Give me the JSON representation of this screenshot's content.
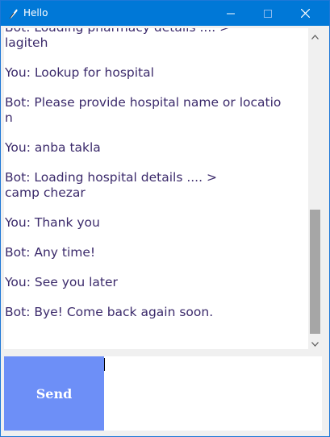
{
  "window": {
    "title": "Hello",
    "icons": {
      "app": "feather-icon",
      "minimize": "minimize-icon",
      "maximize": "maximize-icon",
      "close": "close-icon"
    },
    "colors": {
      "titlebar": "#0078d7"
    }
  },
  "chat": {
    "messages": [
      {
        "lines": [
          "Bot: Loading pharmacy details .... >",
          "lagiteh"
        ]
      },
      {
        "lines": [
          "You: Lookup for hospital"
        ]
      },
      {
        "lines": [
          "Bot: Please provide hospital name or locatio",
          "n"
        ]
      },
      {
        "lines": [
          "You: anba takla"
        ]
      },
      {
        "lines": [
          "Bot: Loading hospital details .... >",
          "camp chezar"
        ]
      },
      {
        "lines": [
          "You: Thank you"
        ]
      },
      {
        "lines": [
          "Bot: Any time!"
        ]
      },
      {
        "lines": [
          "You: See you later"
        ]
      },
      {
        "lines": [
          "Bot: Bye! Come back again soon."
        ]
      }
    ],
    "text_color": "#3b2a6b"
  },
  "scrollbar": {
    "up_icon": "chevron-up-icon",
    "down_icon": "chevron-down-icon",
    "position": 0.57
  },
  "composer": {
    "send_label": "Send",
    "input_value": "",
    "send_color": "#6d8ff7"
  }
}
